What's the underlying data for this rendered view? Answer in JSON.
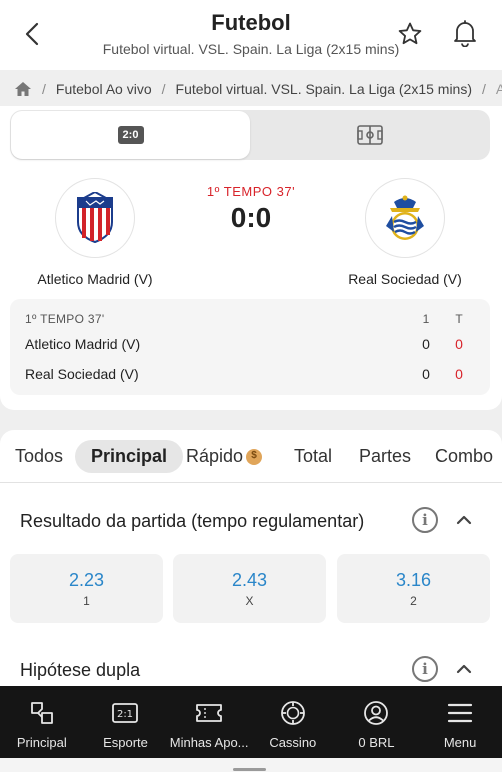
{
  "header": {
    "title": "Futebol",
    "subtitle": "Futebol virtual. VSL. Spain. La Liga (2x15 mins)"
  },
  "breadcrumb": {
    "items": [
      "Futebol Ao vivo",
      "Futebol virtual. VSL. Spain. La Liga (2x15 mins)",
      "A"
    ]
  },
  "view_toggle": {
    "scoreboard_label": "2:0"
  },
  "match": {
    "period": "1º TEMPO 37'",
    "score": "0:0",
    "home_team": "Atletico Madrid (V)",
    "away_team": "Real Sociedad (V)"
  },
  "stats": {
    "period": "1º TEMPO 37'",
    "col_1": "1",
    "col_t": "T",
    "rows": [
      {
        "team": "Atletico Madrid (V)",
        "first": "0",
        "total": "0"
      },
      {
        "team": "Real Sociedad (V)",
        "first": "0",
        "total": "0"
      }
    ]
  },
  "tabs": [
    "Todos",
    "Principal",
    "Rápido",
    "Total",
    "Partes",
    "Combo"
  ],
  "markets": {
    "result_title": "Resultado da partida (tempo regulamentar)",
    "odds": [
      {
        "value": "2.23",
        "label": "1"
      },
      {
        "value": "2.43",
        "label": "X"
      },
      {
        "value": "3.16",
        "label": "2"
      }
    ],
    "double_title": "Hipótese dupla"
  },
  "bottom_nav": [
    {
      "label": "Principal",
      "icon": "principal-icon"
    },
    {
      "label": "Esporte",
      "icon": "scoreboard-icon"
    },
    {
      "label": "Minhas Apo...",
      "icon": "ticket-icon"
    },
    {
      "label": "Cassino",
      "icon": "casino-chip-icon"
    },
    {
      "label": "0 BRL",
      "icon": "account-icon"
    },
    {
      "label": "Menu",
      "icon": "hamburger-icon"
    }
  ],
  "colors": {
    "accent_blue": "#2a86c9",
    "live_red": "#d8232a",
    "nav_bg": "#151515"
  }
}
